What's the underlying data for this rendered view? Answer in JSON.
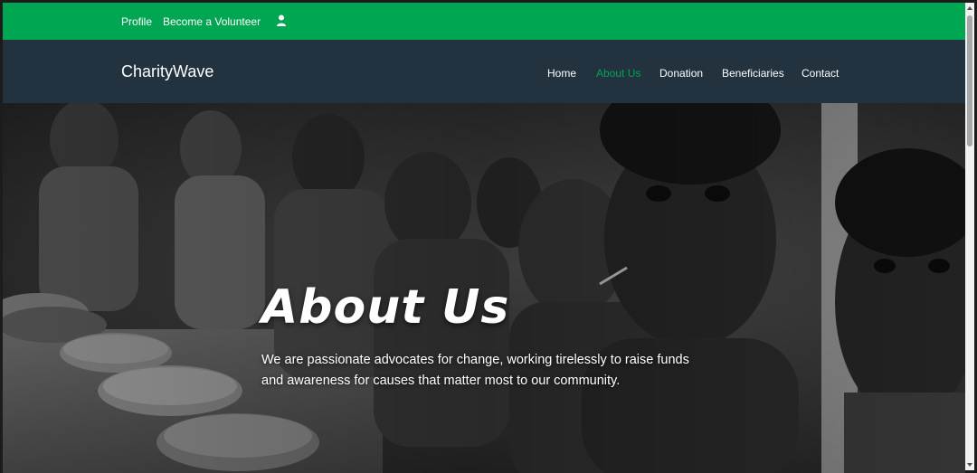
{
  "topbar": {
    "profile_label": "Profile",
    "volunteer_label": "Become a Volunteer",
    "user_icon": "user-icon"
  },
  "navbar": {
    "brand": "CharityWave",
    "links": [
      {
        "label": "Home",
        "active": false
      },
      {
        "label": "About Us",
        "active": true
      },
      {
        "label": "Donation",
        "active": false
      },
      {
        "label": "Beneficiaries",
        "active": false
      },
      {
        "label": "Contact",
        "active": false
      }
    ]
  },
  "hero": {
    "title": "About Us",
    "text": "We are passionate advocates for change, working tirelessly to raise funds and awareness for causes that matter most to our community."
  },
  "colors": {
    "accent": "#00a651",
    "nav_bg": "#22323f",
    "text": "#ffffff"
  }
}
